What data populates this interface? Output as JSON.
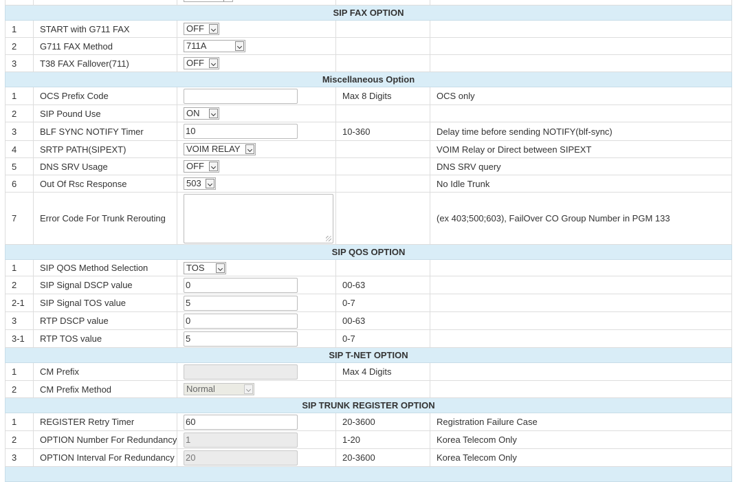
{
  "sections": {
    "fax": {
      "title": "SIP FAX OPTION"
    },
    "misc": {
      "title": "Miscellaneous Option"
    },
    "qos": {
      "title": "SIP QOS OPTION"
    },
    "tnet": {
      "title": "SIP T-NET OPTION"
    },
    "reg": {
      "title": "SIP TRUNK REGISTER OPTION"
    }
  },
  "fax": {
    "r1": {
      "idx": "1",
      "label": "START with G711 FAX",
      "value": "OFF"
    },
    "r2": {
      "idx": "2",
      "label": "G711 FAX Method",
      "value": "711A"
    },
    "r3": {
      "idx": "3",
      "label": "T38 FAX Fallover(711)",
      "value": "OFF"
    }
  },
  "misc": {
    "r1": {
      "idx": "1",
      "label": "OCS Prefix Code",
      "value": "",
      "range": "Max 8 Digits",
      "desc": "OCS only"
    },
    "r2": {
      "idx": "2",
      "label": "SIP Pound Use",
      "value": "ON"
    },
    "r3": {
      "idx": "3",
      "label": "BLF SYNC NOTIFY Timer",
      "value": "10",
      "range": "10-360",
      "desc": "Delay time before sending NOTIFY(blf-sync)"
    },
    "r4": {
      "idx": "4",
      "label": "SRTP PATH(SIPEXT)",
      "value": "VOIM RELAY",
      "desc": "VOIM Relay or Direct between SIPEXT"
    },
    "r5": {
      "idx": "5",
      "label": "DNS SRV Usage",
      "value": "OFF",
      "desc": "DNS SRV query"
    },
    "r6": {
      "idx": "6",
      "label": "Out Of Rsc Response",
      "value": "503",
      "desc": "No Idle Trunk"
    },
    "r7": {
      "idx": "7",
      "label": "Error Code For Trunk Rerouting",
      "value": "",
      "desc": "(ex 403;500;603), FailOver CO Group Number in PGM 133"
    }
  },
  "qos": {
    "r1": {
      "idx": "1",
      "label": "SIP QOS Method Selection",
      "value": "TOS"
    },
    "r2": {
      "idx": "2",
      "label": "SIP Signal DSCP value",
      "value": "0",
      "range": "00-63"
    },
    "r21": {
      "idx": "2-1",
      "label": "SIP Signal TOS value",
      "value": "5",
      "range": "0-7"
    },
    "r3": {
      "idx": "3",
      "label": "RTP DSCP value",
      "value": "0",
      "range": "00-63"
    },
    "r31": {
      "idx": "3-1",
      "label": "RTP TOS value",
      "value": "5",
      "range": "0-7"
    }
  },
  "tnet": {
    "r1": {
      "idx": "1",
      "label": "CM Prefix",
      "value": "",
      "range": "Max 4 Digits"
    },
    "r2": {
      "idx": "2",
      "label": "CM Prefix Method",
      "value": "Normal"
    }
  },
  "reg": {
    "r1": {
      "idx": "1",
      "label": "REGISTER Retry Timer",
      "value": "60",
      "range": "20-3600",
      "desc": "Registration Failure Case"
    },
    "r2": {
      "idx": "2",
      "label": "OPTION Number For Redundancy",
      "value": "1",
      "range": "1-20",
      "desc": "Korea Telecom Only"
    },
    "r3": {
      "idx": "3",
      "label": "OPTION Interval For Redundancy",
      "value": "20",
      "range": "20-3600",
      "desc": "Korea Telecom Only"
    }
  }
}
